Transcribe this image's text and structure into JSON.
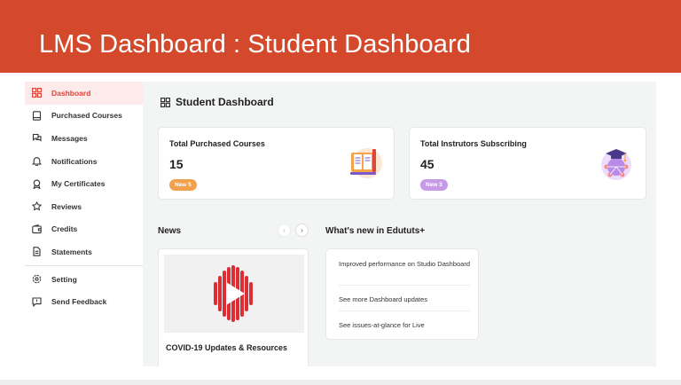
{
  "banner": {
    "title": "LMS Dashboard : Student Dashboard",
    "color": "#d4492b"
  },
  "sidebar": {
    "items": [
      {
        "label": "Dashboard",
        "icon": "grid-icon",
        "active": true
      },
      {
        "label": "Purchased Courses",
        "icon": "book-icon"
      },
      {
        "label": "Messages",
        "icon": "chat-icon"
      },
      {
        "label": "Notifications",
        "icon": "bell-icon"
      },
      {
        "label": "My Certificates",
        "icon": "certificate-icon"
      },
      {
        "label": "Reviews",
        "icon": "star-icon"
      },
      {
        "label": "Credits",
        "icon": "wallet-icon"
      },
      {
        "label": "Statements",
        "icon": "document-icon"
      },
      {
        "label": "Setting",
        "icon": "gear-icon"
      },
      {
        "label": "Send Feedback",
        "icon": "feedback-icon"
      }
    ]
  },
  "main": {
    "title": "Student Dashboard",
    "stats": [
      {
        "label": "Total Purchased Courses",
        "value": "15",
        "badge": "New 5",
        "badge_color": "#f3a04e",
        "icon": "books-illustration-icon"
      },
      {
        "label": "Total Instrutors Subscribing",
        "value": "45",
        "badge": "New 3",
        "badge_color": "#c69ae6",
        "icon": "graduation-network-icon"
      }
    ],
    "news": {
      "title": "News",
      "prev_icon": "chevron-left-icon",
      "next_icon": "chevron-right-icon",
      "card_caption": "COVID-19 Updates & Resources"
    },
    "whats_new": {
      "title": "What's new in Edututs+",
      "items": [
        "Improved performance on Studio Dashboard",
        "See more Dashboard updates",
        "See issues-at-glance for Live"
      ]
    }
  },
  "accent_color": "#e0453a"
}
